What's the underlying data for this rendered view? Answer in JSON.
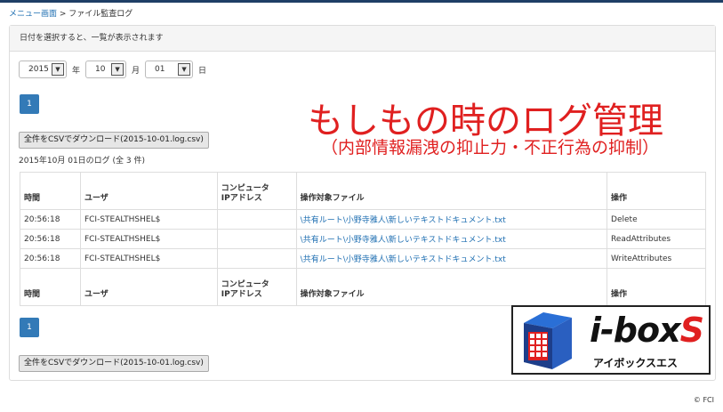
{
  "breadcrumb": {
    "menu": "メニュー画面",
    "separator": " > ",
    "current": "ファイル監査ログ"
  },
  "panel": {
    "instruction": "日付を選択すると、一覧が表示されます"
  },
  "date": {
    "year": "2015",
    "year_label": "年",
    "month": "10",
    "month_label": "月",
    "day": "01",
    "day_label": "日"
  },
  "pagination": {
    "page": "1"
  },
  "download_button": "全件をCSVでダウンロード(2015-10-01.log.csv)",
  "log_title": "2015年10月 01日のログ (全 3 件)",
  "promo": {
    "headline": "もしもの時のログ管理",
    "subline": "（内部情報漏洩の抑止力・不正行為の抑制）"
  },
  "table": {
    "headers": {
      "time": "時間",
      "user": "ユーザ",
      "computer_l1": "コンピュータ",
      "computer_l2": "IPアドレス",
      "file": "操作対象ファイル",
      "op": "操作"
    },
    "rows": [
      {
        "time": "20:56:18",
        "user": "FCI-STEALTHSHEL$",
        "computer": "",
        "file": "\\共有ルート\\小野寺雅人\\新しいテキストドキュメント.txt",
        "op": "Delete"
      },
      {
        "time": "20:56:18",
        "user": "FCI-STEALTHSHEL$",
        "computer": "",
        "file": "\\共有ルート\\小野寺雅人\\新しいテキストドキュメント.txt",
        "op": "ReadAttributes"
      },
      {
        "time": "20:56:18",
        "user": "FCI-STEALTHSHEL$",
        "computer": "",
        "file": "\\共有ルート\\小野寺雅人\\新しいテキストドキュメント.txt",
        "op": "WriteAttributes"
      }
    ]
  },
  "logo": {
    "text_main": "i-box",
    "text_s": "S",
    "kana": "アイボックスエス",
    "icon": "box-logo-icon"
  },
  "copyright": "© FCI",
  "colors": {
    "accent": "#337ab7",
    "promo": "#e02020",
    "topbar": "#1f3f66"
  }
}
